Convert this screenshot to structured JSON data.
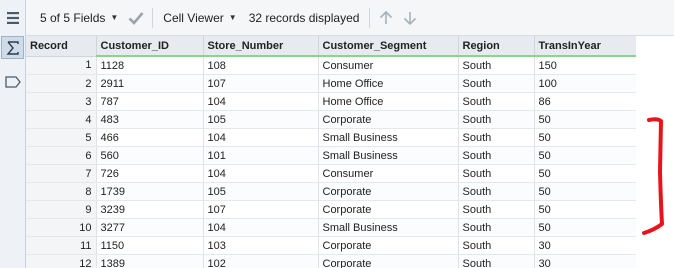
{
  "toolbar": {
    "fields_label": "5 of 5 Fields",
    "viewer_label": "Cell Viewer",
    "records_label": "32 records displayed"
  },
  "columns": [
    "Record",
    "Customer_ID",
    "Store_Number",
    "Customer_Segment",
    "Region",
    "TransInYear"
  ],
  "rows": [
    [
      "1",
      "1128",
      "108",
      "Consumer",
      "South",
      "150"
    ],
    [
      "2",
      "2911",
      "107",
      "Home Office",
      "South",
      "100"
    ],
    [
      "3",
      "787",
      "104",
      "Home Office",
      "South",
      "86"
    ],
    [
      "4",
      "483",
      "105",
      "Corporate",
      "South",
      "50"
    ],
    [
      "5",
      "466",
      "104",
      "Small Business",
      "South",
      "50"
    ],
    [
      "6",
      "560",
      "101",
      "Small Business",
      "South",
      "50"
    ],
    [
      "7",
      "726",
      "104",
      "Consumer",
      "South",
      "50"
    ],
    [
      "8",
      "1739",
      "105",
      "Corporate",
      "South",
      "50"
    ],
    [
      "9",
      "3239",
      "107",
      "Corporate",
      "South",
      "50"
    ],
    [
      "10",
      "3277",
      "104",
      "Small Business",
      "South",
      "50"
    ],
    [
      "11",
      "1150",
      "103",
      "Corporate",
      "South",
      "30"
    ],
    [
      "12",
      "1389",
      "102",
      "Corporate",
      "South",
      "30"
    ]
  ],
  "icons": {
    "sidebar": [
      "list-icon",
      "sigma-icon",
      "tag-icon"
    ],
    "toolbar": [
      "chevron-down-icon",
      "checkmark-icon",
      "arrow-up-icon",
      "arrow-down-icon"
    ]
  },
  "colors": {
    "header_underline": "#8fd18f",
    "annotation": "#e8141c"
  }
}
